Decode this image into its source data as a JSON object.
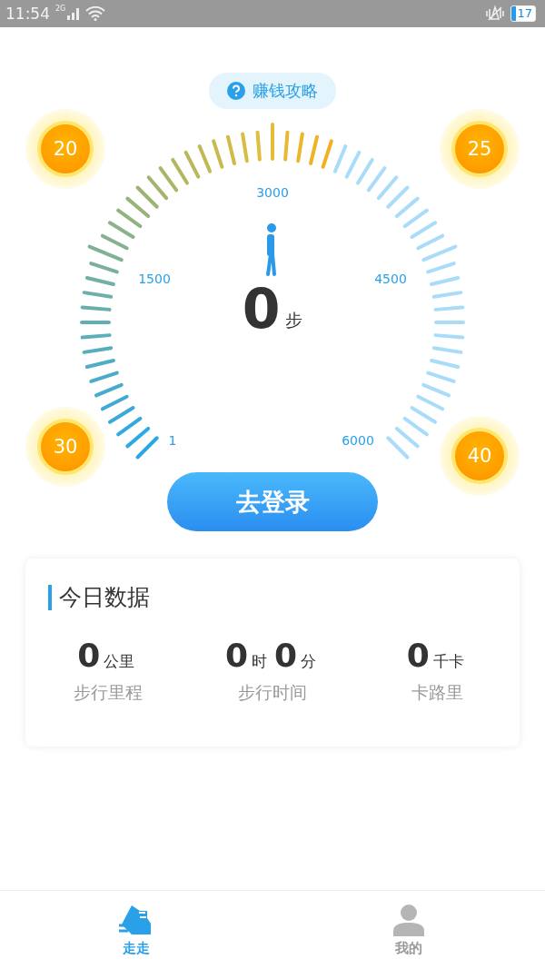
{
  "status_bar": {
    "time": "11:54",
    "network": "2G",
    "battery": "17"
  },
  "guide_button": {
    "label": "赚钱攻略"
  },
  "coins": [
    {
      "label": "20"
    },
    {
      "label": "25"
    },
    {
      "label": "30"
    },
    {
      "label": "40"
    }
  ],
  "gauge": {
    "scale_labels": [
      "1",
      "1500",
      "3000",
      "4500",
      "6000"
    ],
    "steps": "0",
    "unit": "步"
  },
  "login_button": {
    "label": "去登录"
  },
  "today": {
    "title": "今日数据",
    "stats": [
      {
        "parts": [
          {
            "value": "0",
            "unit": "公里"
          }
        ],
        "label": "步行里程"
      },
      {
        "parts": [
          {
            "value": "0",
            "unit": "时"
          },
          {
            "value": "0",
            "unit": "分"
          }
        ],
        "label": "步行时间"
      },
      {
        "parts": [
          {
            "value": "0",
            "unit": "千卡"
          }
        ],
        "label": "卡路里"
      }
    ]
  },
  "tabs": [
    {
      "label": "走走",
      "kind": "walk",
      "selected": true
    },
    {
      "label": "我的",
      "kind": "profile",
      "selected": false
    }
  ]
}
